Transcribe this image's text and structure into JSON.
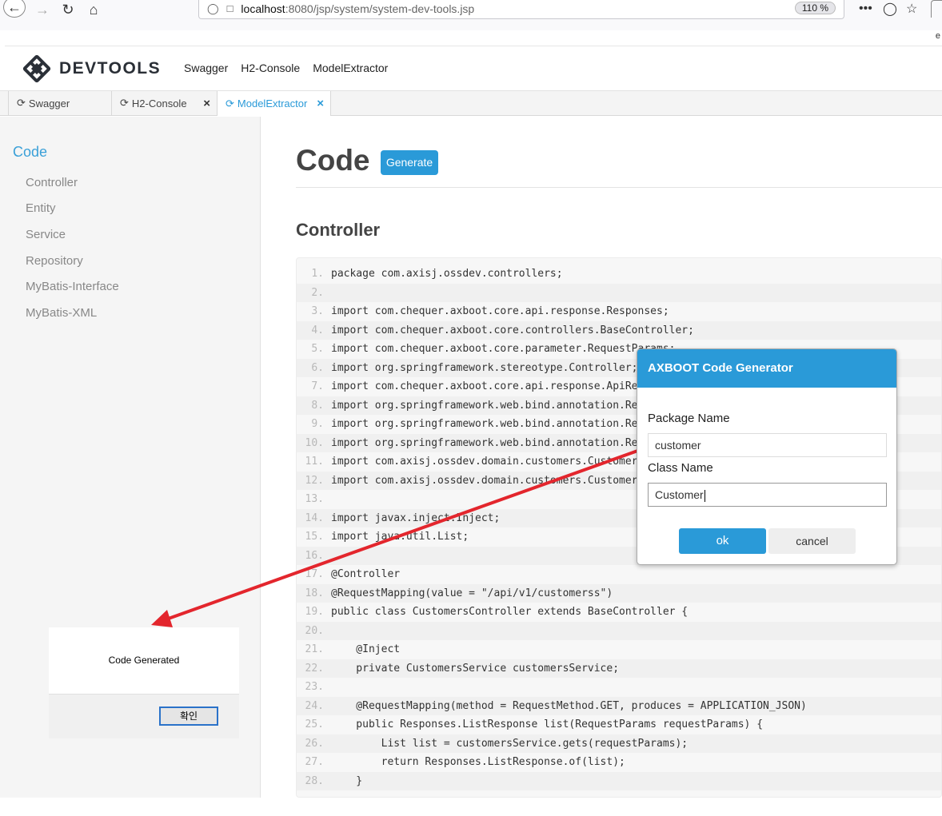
{
  "browser": {
    "url_host": "localhost",
    "url_path": ":8080/jsp/system/system-dev-tools.jsp",
    "zoom": "110 %",
    "trailing_char": "e"
  },
  "header": {
    "logo_text": "DEVTOOLS",
    "menu": [
      "Swagger",
      "H2-Console",
      "ModelExtractor"
    ]
  },
  "tabs": [
    {
      "label": "Swagger",
      "active": false,
      "closable": false
    },
    {
      "label": "H2-Console",
      "active": false,
      "closable": true
    },
    {
      "label": "ModelExtractor",
      "active": true,
      "closable": true
    }
  ],
  "sidebar": {
    "title": "Code",
    "items": [
      "Controller",
      "Entity",
      "Service",
      "Repository",
      "MyBatis-Interface",
      "MyBatis-XML"
    ]
  },
  "main": {
    "title": "Code",
    "generate_label": "Generate",
    "section_title": "Controller"
  },
  "code": [
    {
      "n": "1.",
      "t": "package com.axisj.ossdev.controllers;"
    },
    {
      "n": "2.",
      "t": ""
    },
    {
      "n": "3.",
      "t": "import com.chequer.axboot.core.api.response.Responses;"
    },
    {
      "n": "4.",
      "t": "import com.chequer.axboot.core.controllers.BaseController;"
    },
    {
      "n": "5.",
      "t": "import com.chequer.axboot.core.parameter.RequestParams;"
    },
    {
      "n": "6.",
      "t": "import org.springframework.stereotype.Controller;"
    },
    {
      "n": "7.",
      "t": "import com.chequer.axboot.core.api.response.ApiRe"
    },
    {
      "n": "8.",
      "t": "import org.springframework.web.bind.annotation.Re"
    },
    {
      "n": "9.",
      "t": "import org.springframework.web.bind.annotation.Re"
    },
    {
      "n": "10.",
      "t": "import org.springframework.web.bind.annotation.Re"
    },
    {
      "n": "11.",
      "t": "import com.axisj.ossdev.domain.customers.Customer"
    },
    {
      "n": "12.",
      "t": "import com.axisj.ossdev.domain.customers.Customer"
    },
    {
      "n": "13.",
      "t": ""
    },
    {
      "n": "14.",
      "t": "import javax.inject.Inject;"
    },
    {
      "n": "15.",
      "t": "import java.util.List;"
    },
    {
      "n": "16.",
      "t": ""
    },
    {
      "n": "17.",
      "t": "@Controller"
    },
    {
      "n": "18.",
      "t": "@RequestMapping(value = \"/api/v1/customerss\")"
    },
    {
      "n": "19.",
      "t": "public class CustomersController extends BaseController {"
    },
    {
      "n": "20.",
      "t": ""
    },
    {
      "n": "21.",
      "t": "    @Inject"
    },
    {
      "n": "22.",
      "t": "    private CustomersService customersService;"
    },
    {
      "n": "23.",
      "t": ""
    },
    {
      "n": "24.",
      "t": "    @RequestMapping(method = RequestMethod.GET, produces = APPLICATION_JSON)"
    },
    {
      "n": "25.",
      "t": "    public Responses.ListResponse list(RequestParams requestParams) {"
    },
    {
      "n": "26.",
      "t": "        List list = customersService.gets(requestParams);"
    },
    {
      "n": "27.",
      "t": "        return Responses.ListResponse.of(list);"
    },
    {
      "n": "28.",
      "t": "    }"
    }
  ],
  "alert": {
    "message": "Code Generated",
    "ok_label": "확인"
  },
  "modal": {
    "title": "AXBOOT Code Generator",
    "package_label": "Package Name",
    "package_value": "customer",
    "class_label": "Class Name",
    "class_value": "Customer",
    "ok_label": "ok",
    "cancel_label": "cancel"
  },
  "colors": {
    "accent": "#2a9ad8",
    "arrow": "#e3262d"
  }
}
